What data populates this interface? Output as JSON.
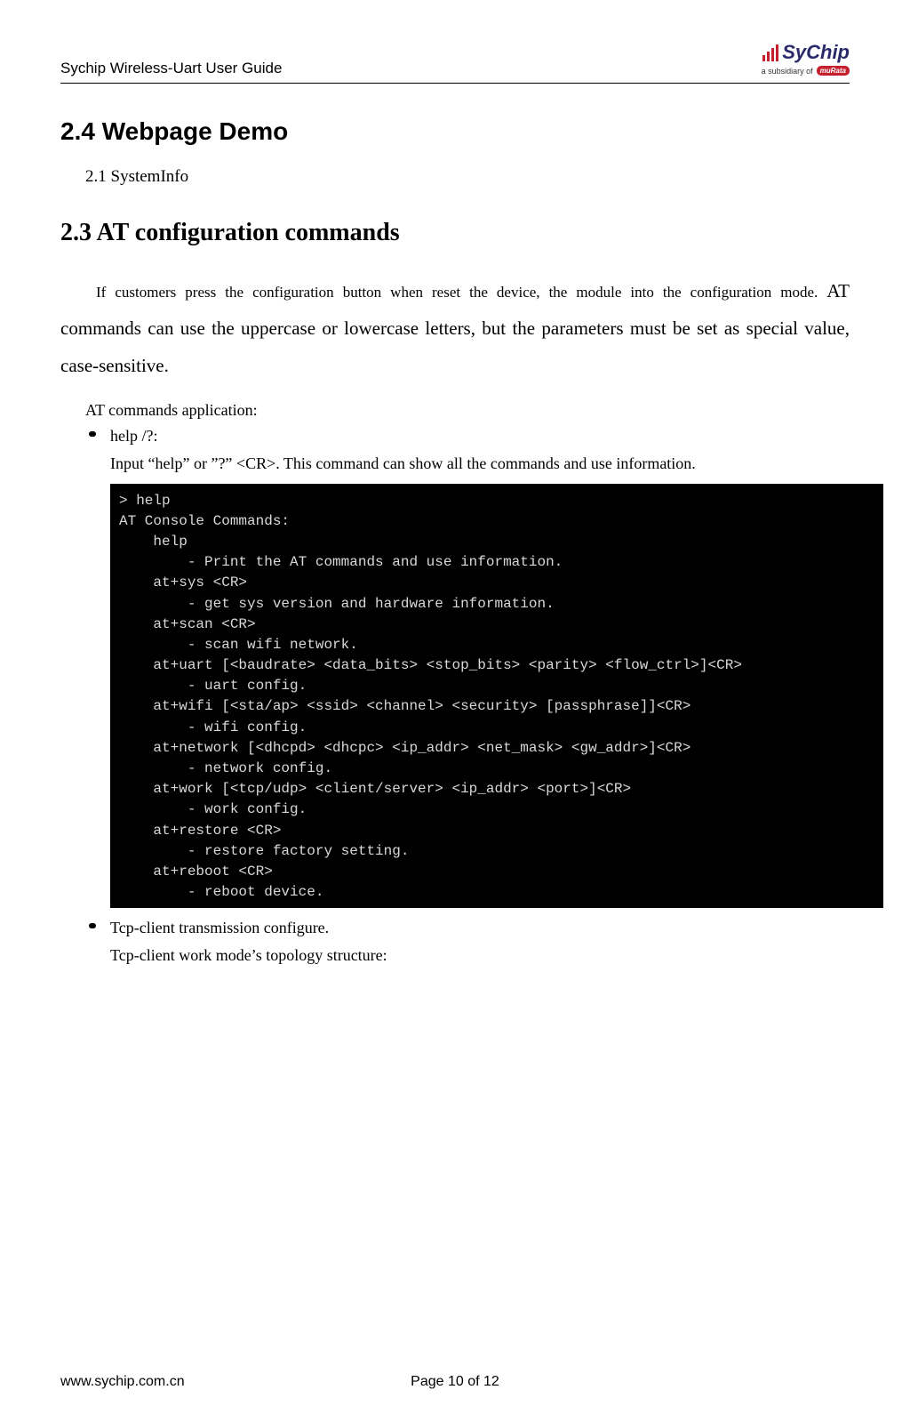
{
  "header": {
    "title": "Sychip Wireless-Uart User Guide",
    "logo_name": "SyChip",
    "logo_sub": "a subsidiary of",
    "logo_brand": "muRata"
  },
  "headings": {
    "webpage_demo": "2.4 Webpage Demo",
    "systeminfo": "2.1 SystemInfo",
    "at_config": "2.3 AT configuration commands"
  },
  "body": {
    "para1_small": "If customers press the configuration button when reset the device, the module into the configuration mode. ",
    "para1_large": "AT commands can use the uppercase or lowercase letters, but the parameters must be set as special value, case-sensitive.",
    "at_app_label": "AT commands application:",
    "bullet1_title": "help /?:",
    "bullet1_desc": "Input “help” or ”?” <CR>. This command can show all the commands and use information.",
    "bullet2_title": "Tcp-client transmission configure.",
    "bullet2_desc": "Tcp-client work mode’s topology structure:"
  },
  "terminal": {
    "lines": "> help\nAT Console Commands:\n    help\n        - Print the AT commands and use information.\n    at+sys <CR>\n        - get sys version and hardware information.\n    at+scan <CR>\n        - scan wifi network.\n    at+uart [<baudrate> <data_bits> <stop_bits> <parity> <flow_ctrl>]<CR>\n        - uart config.\n    at+wifi [<sta/ap> <ssid> <channel> <security> [passphrase]]<CR>\n        - wifi config.\n    at+network [<dhcpd> <dhcpc> <ip_addr> <net_mask> <gw_addr>]<CR>\n        - network config.\n    at+work [<tcp/udp> <client/server> <ip_addr> <port>]<CR>\n        - work config.\n    at+restore <CR>\n        - restore factory setting.\n    at+reboot <CR>\n        - reboot device."
  },
  "footer": {
    "url": "www.sychip.com.cn",
    "page": "Page 10 of 12"
  }
}
